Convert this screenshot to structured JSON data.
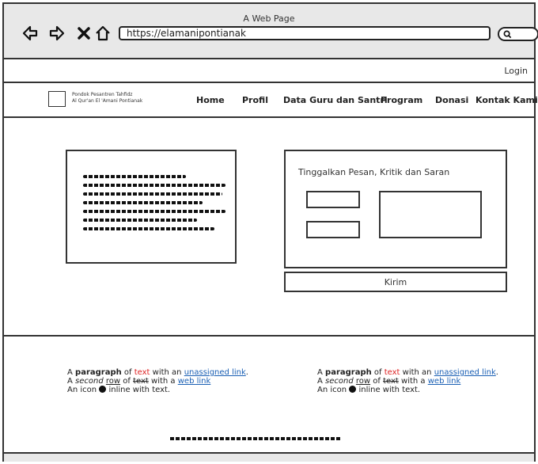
{
  "window": {
    "title": "A Web Page"
  },
  "toolbar": {
    "url": "https://elamanipontianak"
  },
  "icons": {
    "back": "back-arrow-icon",
    "forward": "forward-arrow-icon",
    "stop": "close-icon",
    "home": "home-icon",
    "search": "search-icon"
  },
  "topbar": {
    "login": "Login"
  },
  "logo": {
    "line1": "Pondok Pesantren Tahfidz",
    "line2": "Al Qur'an El 'Amani Pontianak"
  },
  "nav": [
    {
      "label": "Home"
    },
    {
      "label": "Profil"
    },
    {
      "label": "Data Guru dan Santri"
    },
    {
      "label": "Program"
    },
    {
      "label": "Donasi"
    },
    {
      "label": "Kontak Kami"
    }
  ],
  "form": {
    "title": "Tinggalkan Pesan, Kritik dan Saran",
    "submit": "Kirim"
  },
  "footer": {
    "p_a": "A ",
    "p_bold": "paragraph",
    "p_of": " of ",
    "p_text": "text",
    "p_with": " with an ",
    "p_link": "unassigned link",
    "p_end": ".",
    "r_a": "A ",
    "r_second": "second",
    "r_space": " ",
    "r_row": "row",
    "r_of": " of ",
    "r_text": "text",
    "r_with": " with a ",
    "r_link": "web link",
    "i_a": "An icon ",
    "i_b": " inline with text."
  }
}
